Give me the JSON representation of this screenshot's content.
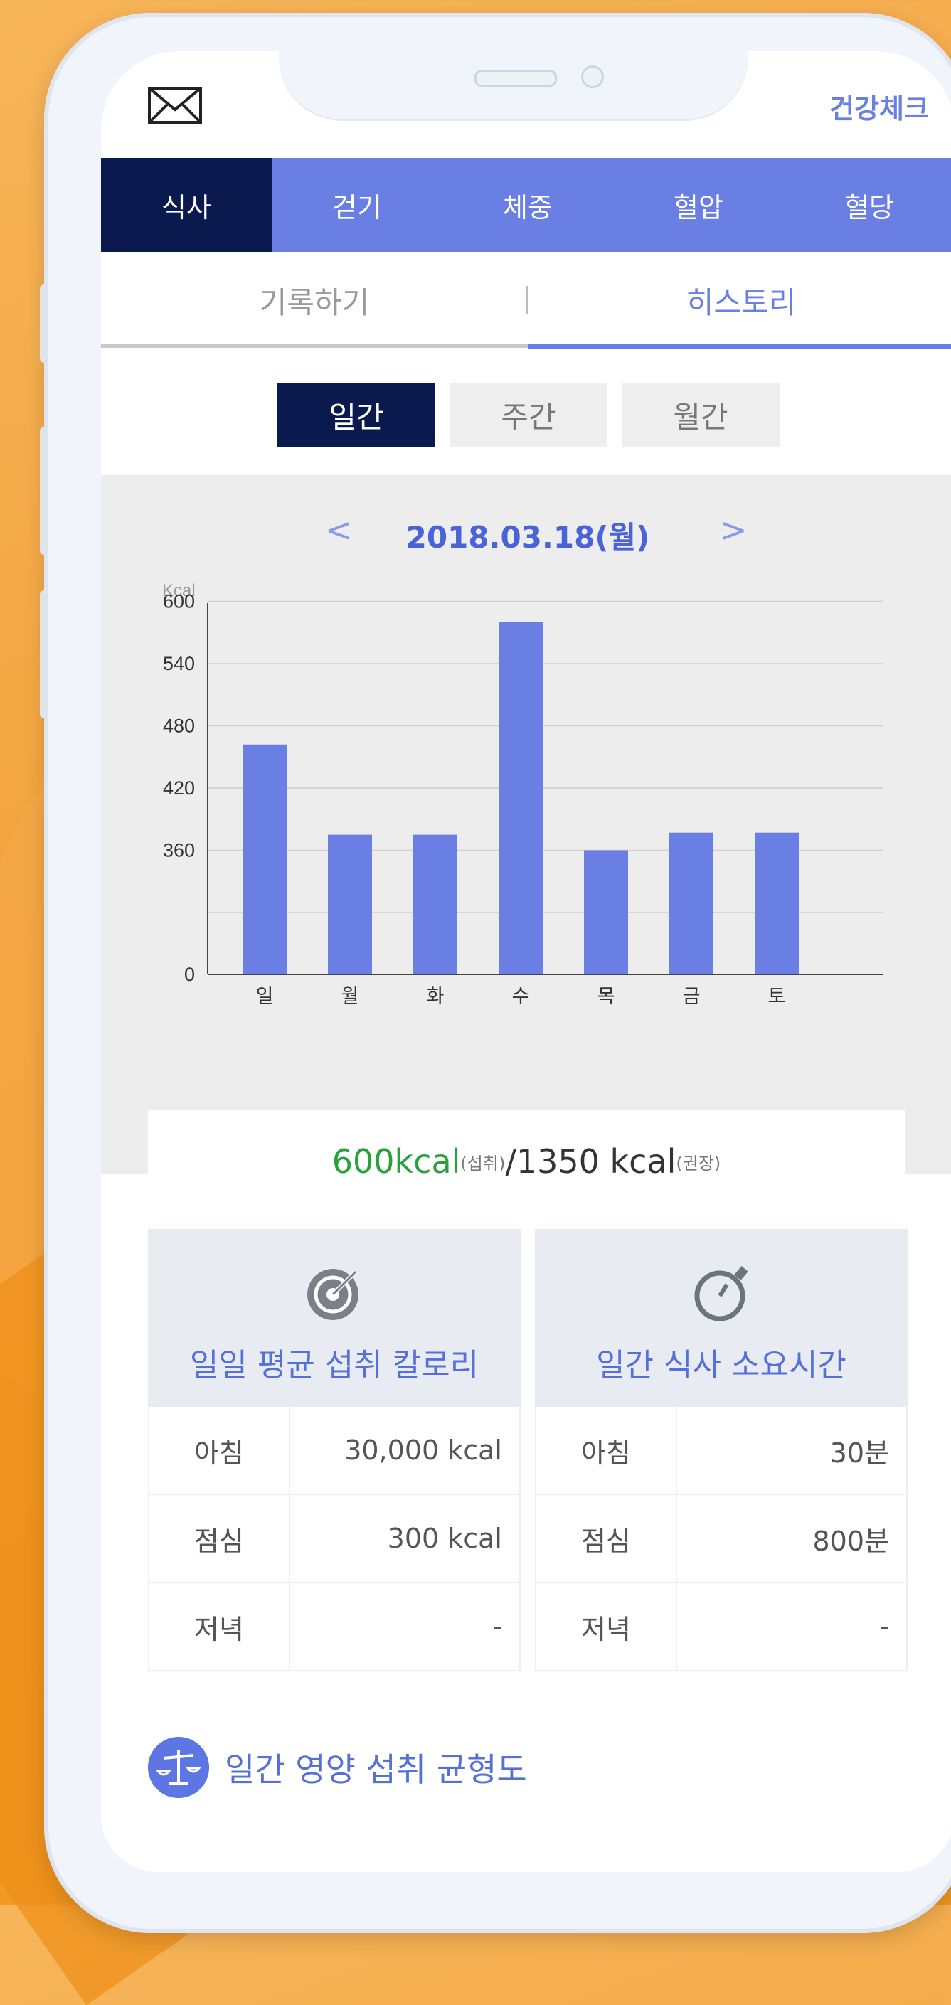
{
  "header": {
    "right_label": "건강체크"
  },
  "tabs": [
    "식사",
    "걷기",
    "체중",
    "혈압",
    "혈당"
  ],
  "subtabs": {
    "record": "기록하기",
    "history": "히스토리"
  },
  "periods": [
    "일간",
    "주간",
    "월간"
  ],
  "date": "2018.03.18(월)",
  "nav": {
    "prev": "<",
    "next": ">"
  },
  "chart_data": {
    "type": "bar",
    "ylabel": "Kcal",
    "categories": [
      "일",
      "월",
      "화",
      "수",
      "목",
      "금",
      "토"
    ],
    "values": [
      462,
      375,
      375,
      580,
      360,
      377,
      377
    ],
    "yticks": [
      0,
      360,
      420,
      480,
      540,
      600
    ],
    "color": "#6a7fe3"
  },
  "summary": {
    "intake_value": "600",
    "intake_unit": "kcal",
    "intake_note": "(섭취)",
    "sep": " / ",
    "recommended": "1350 kcal",
    "recommended_note": "(권장)"
  },
  "cards": {
    "calorie": {
      "title": "일일 평균 섭취 칼로리",
      "rows": [
        {
          "label": "아침",
          "value": "30,000 kcal"
        },
        {
          "label": "점심",
          "value": "300 kcal"
        },
        {
          "label": "저녁",
          "value": "-"
        }
      ]
    },
    "time": {
      "title": "일간 식사 소요시간",
      "rows": [
        {
          "label": "아침",
          "value": "30분"
        },
        {
          "label": "점심",
          "value": "800분"
        },
        {
          "label": "저녁",
          "value": "-"
        }
      ]
    }
  },
  "balance": {
    "label": "일간 영양 섭취 균형도"
  }
}
